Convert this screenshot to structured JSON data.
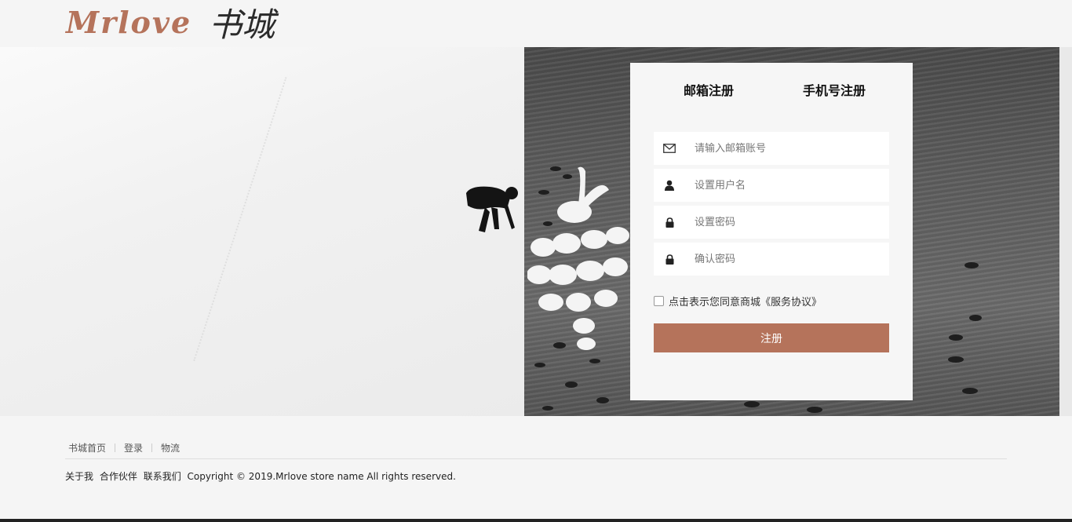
{
  "header": {
    "logo_en": "Mrlove",
    "logo_cn": "书城"
  },
  "tabs": {
    "email": "邮箱注册",
    "phone": "手机号注册"
  },
  "form": {
    "email_placeholder": "请输入邮箱账号",
    "username_placeholder": "设置用户名",
    "password_placeholder": "设置密码",
    "confirm_placeholder": "确认密码",
    "agree_text": "点击表示您同意商城《服务协议》",
    "submit_label": "注册"
  },
  "footer": {
    "links": [
      "书城首页",
      "登录",
      "物流"
    ],
    "about": "关于我",
    "partners": "合作伙伴",
    "contact": "联系我们",
    "copyright": "Copyright © 2019.Mrlove store name All rights reserved."
  },
  "colors": {
    "accent": "#b5735b",
    "logo_cn": "#2b2b2b"
  },
  "icons": [
    "envelope-icon",
    "user-icon",
    "lock-icon",
    "lock-icon"
  ]
}
